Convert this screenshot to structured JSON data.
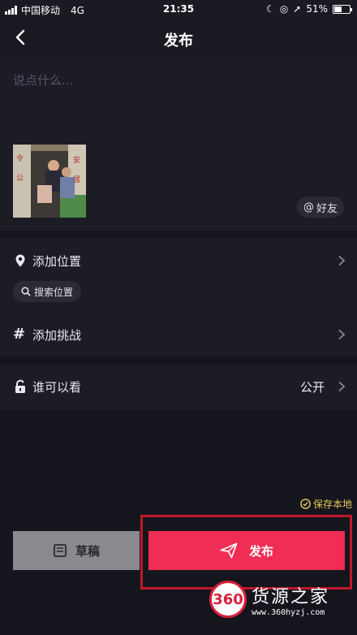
{
  "status": {
    "carrier": "中国移动",
    "network": "4G",
    "time": "21:35",
    "battery": "51%",
    "battery_level": 0.51
  },
  "header": {
    "title": "发布",
    "back_icon": "chevron-left-icon"
  },
  "compose": {
    "placeholder": "说点什么...",
    "friend_label": "好友",
    "friend_icon": "at-icon"
  },
  "options": {
    "location_label": "添加位置",
    "search_location_label": "搜索位置",
    "challenge_label": "添加挑战"
  },
  "visibility": {
    "label": "谁可以看",
    "value": "公开"
  },
  "footer": {
    "save_local_label": "保存本地",
    "draft_label": "草稿",
    "publish_label": "发布"
  },
  "watermark": {
    "logo": "360",
    "name": "货源之家",
    "url": "www.360hyzj.com"
  },
  "colors": {
    "publish": "#f02d55",
    "highlight": "#c0182c",
    "save_local": "#e7c95a"
  }
}
